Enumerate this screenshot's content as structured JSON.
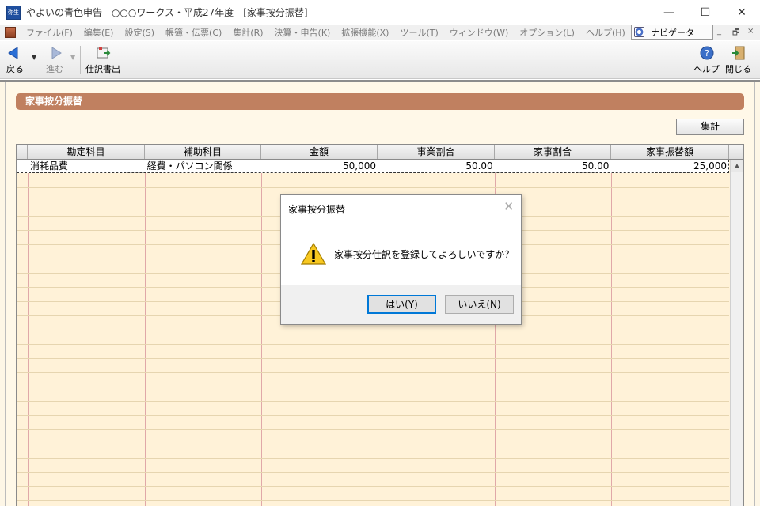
{
  "window": {
    "title": "やよいの青色申告 - ○○○ワークス・平成27年度 - [家事按分振替]",
    "app_icon_text": "弥生",
    "controls": [
      "—",
      "☐",
      "✕"
    ]
  },
  "menubar": {
    "items": [
      "ファイル(F)",
      "編集(E)",
      "設定(S)",
      "帳簿・伝票(C)",
      "集計(R)",
      "決算・申告(K)",
      "拡張機能(X)",
      "ツール(T)",
      "ウィンドウ(W)",
      "オプション(L)",
      "ヘルプ(H)"
    ],
    "navigator_label": "ナビゲータ",
    "mdi_controls": [
      "_",
      "🗗",
      "×"
    ]
  },
  "toolbar": {
    "back_label": "戻る",
    "forward_label": "進む",
    "journal_out_label": "仕訳書出",
    "help_label": "ヘルプ",
    "close_label": "閉じる"
  },
  "section": {
    "title": "家事按分振替",
    "sum_button": "集計"
  },
  "table": {
    "columns": [
      "勘定科目",
      "補助科目",
      "金額",
      "事業割合",
      "家事割合",
      "家事振替額"
    ],
    "rows": [
      [
        "消耗品費",
        "経費・パソコン関係",
        "50,000",
        "50.00",
        "50.00",
        "25,000"
      ]
    ]
  },
  "dialog": {
    "title": "家事按分振替",
    "message": "家事按分仕訳を登録してよろしいですか？",
    "yes_label": "はい(Y)",
    "no_label": "いいえ(N)"
  },
  "colors": {
    "section_header": "#c08060",
    "grid_bg": "#fff2d8",
    "primary_border": "#0078d7"
  }
}
